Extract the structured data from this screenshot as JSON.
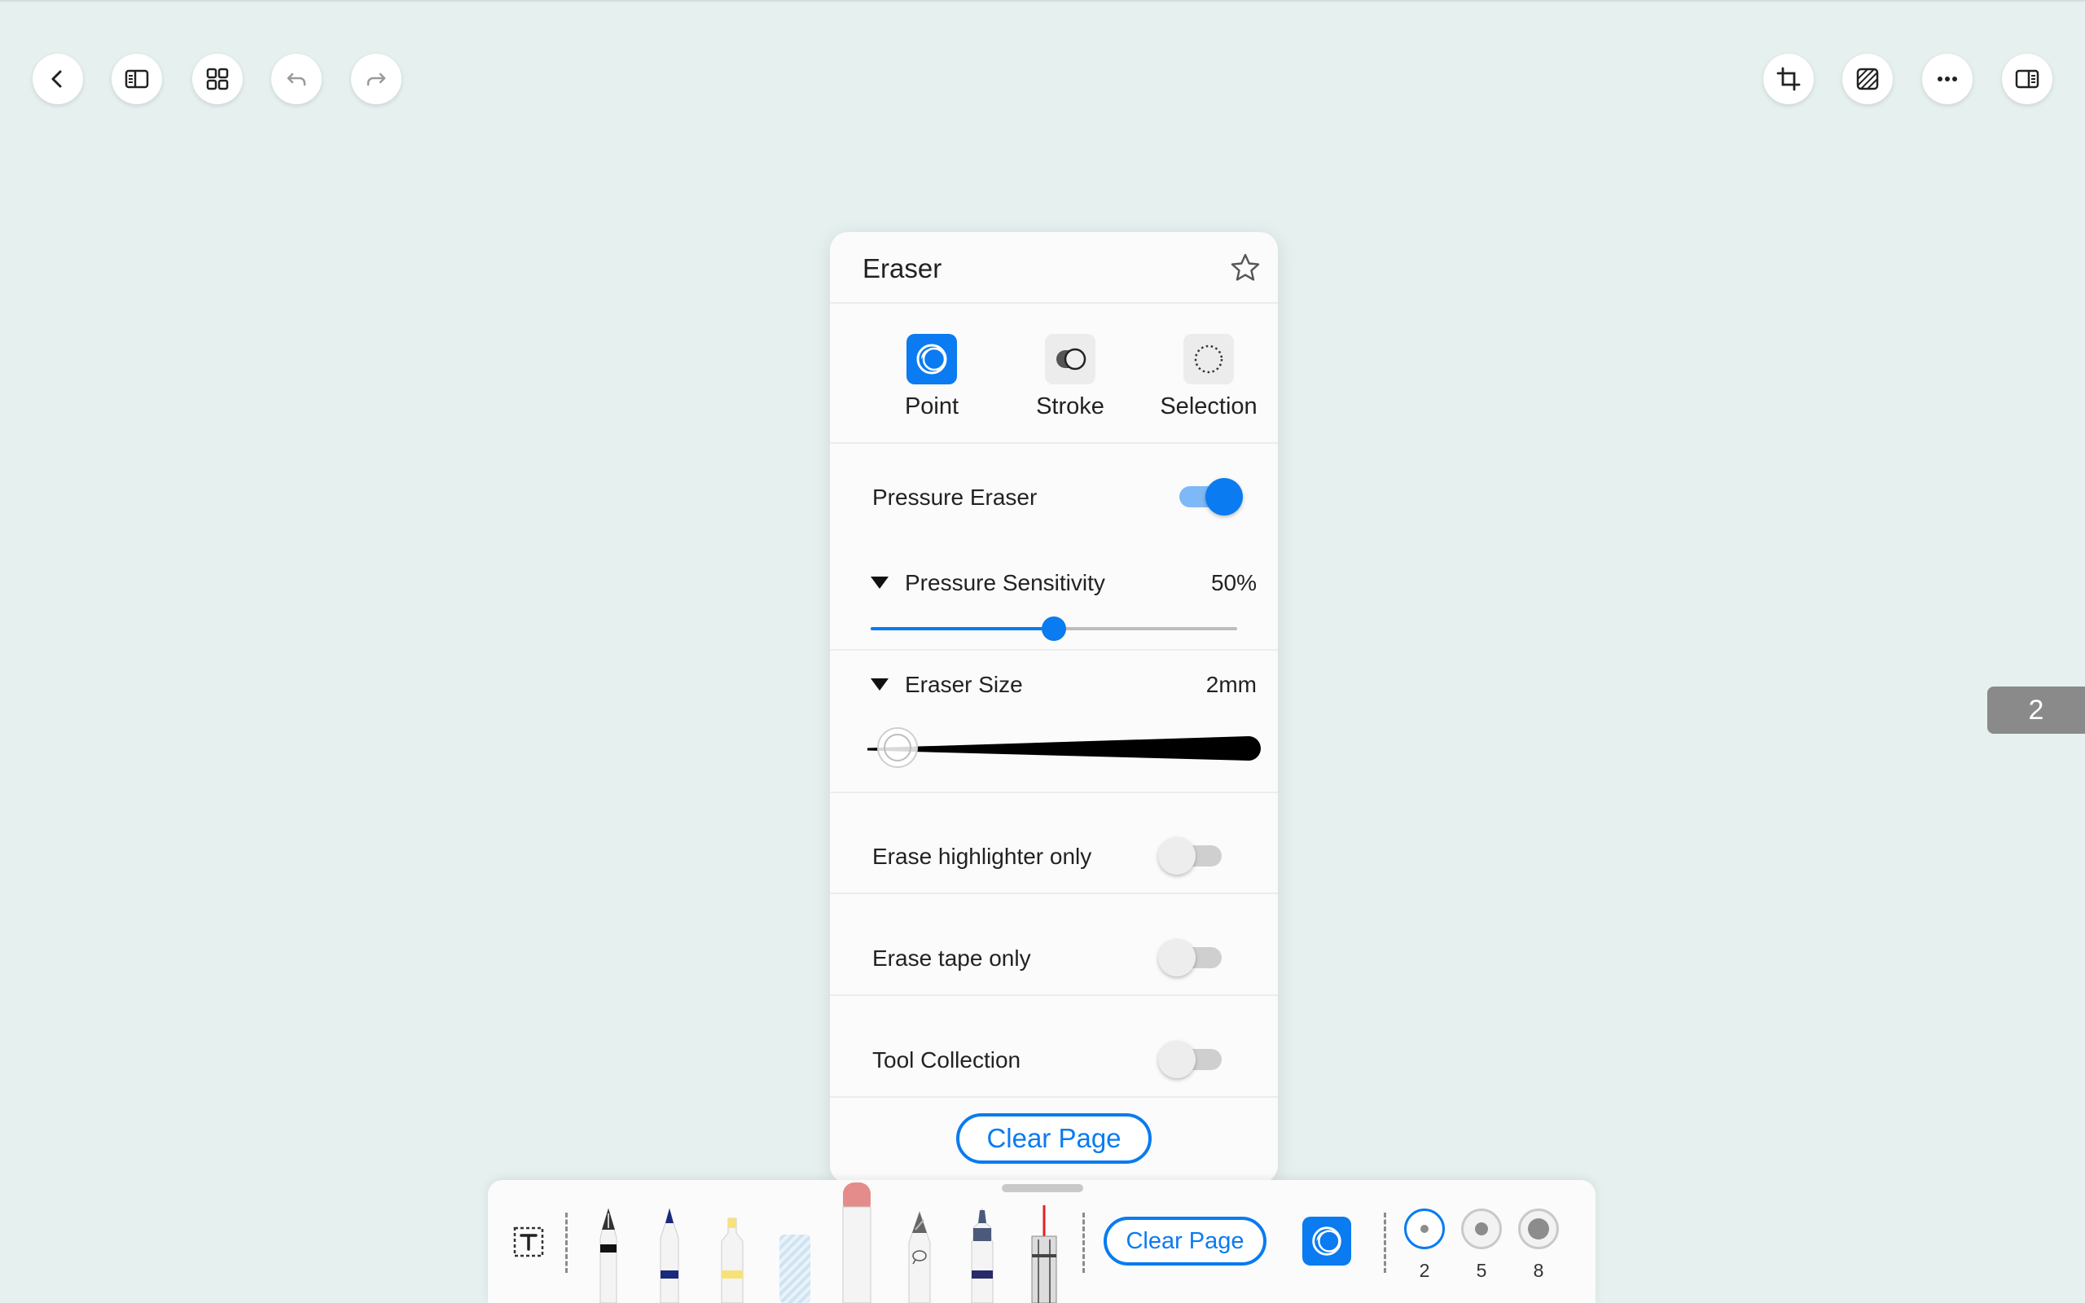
{
  "colors": {
    "accent": "#0a7bf0",
    "background": "#e6f0ef",
    "panel": "#fbfbfb"
  },
  "toolbar": {
    "left_icons": [
      "back-icon",
      "sidebar-toggle-icon",
      "thumbnails-grid-icon",
      "undo-icon",
      "redo-icon"
    ],
    "right_icons": [
      "crop-icon",
      "background-pattern-icon",
      "more-icon",
      "split-view-icon"
    ]
  },
  "eraser_panel": {
    "title": "Eraser",
    "favorite_icon": "star-icon",
    "modes": [
      {
        "label": "Point",
        "icon": "point-eraser-icon",
        "active": true
      },
      {
        "label": "Stroke",
        "icon": "stroke-eraser-icon",
        "active": false
      },
      {
        "label": "Selection",
        "icon": "selection-eraser-icon",
        "active": false
      }
    ],
    "pressure_eraser": {
      "label": "Pressure Eraser",
      "enabled": true
    },
    "pressure_sensitivity": {
      "label": "Pressure Sensitivity",
      "value_text": "50%",
      "value": 0.5
    },
    "eraser_size": {
      "label": "Eraser Size",
      "value_text": "2mm",
      "value": 0.1
    },
    "erase_highlighter_only": {
      "label": "Erase highlighter only",
      "enabled": false
    },
    "erase_tape_only": {
      "label": "Erase tape only",
      "enabled": false
    },
    "tool_collection": {
      "label": "Tool Collection",
      "enabled": false
    },
    "clear_page": "Clear Page"
  },
  "page_indicator": "2",
  "dock": {
    "tools": [
      "text-box-tool",
      "fountain-pen",
      "marker-pen",
      "highlighter",
      "tape",
      "eraser",
      "pencil-lasso",
      "brush-pen",
      "laser-pointer"
    ],
    "clear_page": "Clear Page",
    "eraser_mode_icon": "point-eraser-icon",
    "sizes": [
      {
        "label": "2",
        "selected": true
      },
      {
        "label": "5",
        "selected": false
      },
      {
        "label": "8",
        "selected": false
      }
    ]
  }
}
